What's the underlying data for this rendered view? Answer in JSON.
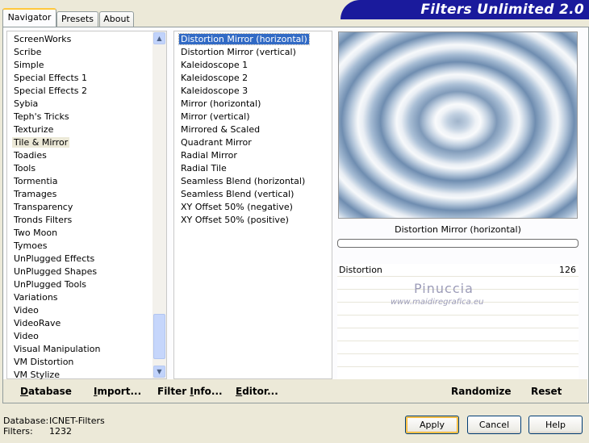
{
  "tabs": [
    {
      "label": "Navigator"
    },
    {
      "label": "Presets"
    },
    {
      "label": "About"
    }
  ],
  "banner": {
    "title": "Filters Unlimited 2.0"
  },
  "categories": {
    "items": [
      "ScreenWorks",
      "Scribe",
      "Simple",
      "Special Effects 1",
      "Special Effects 2",
      "Sybia",
      "Teph's Tricks",
      "Texturize",
      "Tile & Mirror",
      "Toadies",
      "Tools",
      "Tormentia",
      "Tramages",
      "Transparency",
      "Tronds Filters",
      "Two Moon",
      "Tymoes",
      "UnPlugged Effects",
      "UnPlugged Shapes",
      "UnPlugged Tools",
      "Variations",
      "Video",
      "VideoRave",
      "Video",
      "Visual Manipulation",
      "VM Distortion",
      "VM Stylize"
    ],
    "selected": "Tile & Mirror"
  },
  "filters": {
    "items": [
      "Distortion Mirror (horizontal)",
      "Distortion Mirror (vertical)",
      "Kaleidoscope 1",
      "Kaleidoscope 2",
      "Kaleidoscope 3",
      "Mirror (horizontal)",
      "Mirror (vertical)",
      "Mirrored & Scaled",
      "Quadrant Mirror",
      "Radial Mirror",
      "Radial Tile",
      "Seamless Blend (horizontal)",
      "Seamless Blend (vertical)",
      "XY Offset 50% (negative)",
      "XY Offset 50% (positive)"
    ],
    "selected": "Distortion Mirror (horizontal)"
  },
  "preview": {
    "filter_name": "Distortion Mirror (horizontal)"
  },
  "params": [
    {
      "label": "Distortion",
      "value": "126"
    }
  ],
  "watermark": {
    "name": "Pinuccia",
    "url": "www.maidiregrafica.eu"
  },
  "toolbar": {
    "database": "Database",
    "import": "Import...",
    "filter_info": "Filter Info...",
    "editor": "Editor...",
    "randomize": "Randomize",
    "reset": "Reset"
  },
  "status": {
    "database_label": "Database:",
    "database_value": "ICNET-Filters",
    "filters_label": "Filters:",
    "filters_value": "1232"
  },
  "buttons": {
    "apply": "Apply",
    "cancel": "Cancel",
    "help": "Help"
  },
  "colors": {
    "banner": "#1a1a9c",
    "selection": "#316ac5",
    "background": "#ece9d8"
  }
}
